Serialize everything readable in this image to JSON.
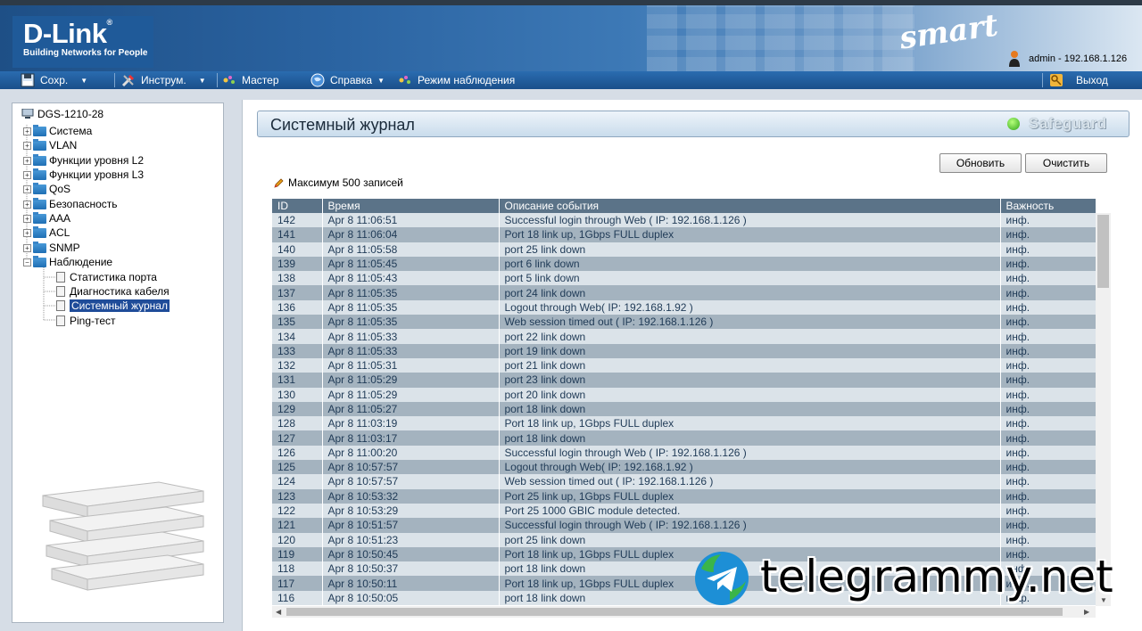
{
  "header": {
    "brand": "D-Link",
    "tagline": "Building Networks for People",
    "product_line": "smart",
    "user_info": "admin - 192.168.1.126"
  },
  "menubar": {
    "save": "Сохр.",
    "tools": "Инструм.",
    "wizard": "Мастер",
    "help": "Справка",
    "surveillance": "Режим наблюдения",
    "logout": "Выход"
  },
  "tree": {
    "root": "DGS-1210-28",
    "items": [
      "Система",
      "VLAN",
      "Функции уровня L2",
      "Функции уровня L3",
      "QoS",
      "Безопасность",
      "AAA",
      "ACL",
      "SNMP",
      "Наблюдение"
    ],
    "children": [
      "Статистика порта",
      "Диагностика кабеля",
      "Системный журнал",
      "Ping-тест"
    ]
  },
  "page": {
    "title": "Системный журнал",
    "badge": "Safeguard",
    "refresh_button": "Обновить",
    "clear_button": "Очистить",
    "note": "Максимум 500 записей"
  },
  "log": {
    "columns": [
      "ID",
      "Время",
      "Описание события",
      "Важность"
    ],
    "rows": [
      [
        "142",
        "Apr 8 11:06:51",
        "Successful login through Web ( IP: 192.168.1.126 )",
        "инф."
      ],
      [
        "141",
        "Apr 8 11:06:04",
        "Port 18 link up, 1Gbps FULL duplex",
        "инф."
      ],
      [
        "140",
        "Apr 8 11:05:58",
        "port 25 link down",
        "инф."
      ],
      [
        "139",
        "Apr 8 11:05:45",
        "port 6 link down",
        "инф."
      ],
      [
        "138",
        "Apr 8 11:05:43",
        "port 5 link down",
        "инф."
      ],
      [
        "137",
        "Apr 8 11:05:35",
        "port 24 link down",
        "инф."
      ],
      [
        "136",
        "Apr 8 11:05:35",
        "Logout through Web( IP: 192.168.1.92 )",
        "инф."
      ],
      [
        "135",
        "Apr 8 11:05:35",
        "Web session timed out ( IP: 192.168.1.126 )",
        "инф."
      ],
      [
        "134",
        "Apr 8 11:05:33",
        "port 22 link down",
        "инф."
      ],
      [
        "133",
        "Apr 8 11:05:33",
        "port 19 link down",
        "инф."
      ],
      [
        "132",
        "Apr 8 11:05:31",
        "port 21 link down",
        "инф."
      ],
      [
        "131",
        "Apr 8 11:05:29",
        "port 23 link down",
        "инф."
      ],
      [
        "130",
        "Apr 8 11:05:29",
        "port 20 link down",
        "инф."
      ],
      [
        "129",
        "Apr 8 11:05:27",
        "port 18 link down",
        "инф."
      ],
      [
        "128",
        "Apr 8 11:03:19",
        "Port 18 link up, 1Gbps FULL duplex",
        "инф."
      ],
      [
        "127",
        "Apr 8 11:03:17",
        "port 18 link down",
        "инф."
      ],
      [
        "126",
        "Apr 8 11:00:20",
        "Successful login through Web ( IP: 192.168.1.126 )",
        "инф."
      ],
      [
        "125",
        "Apr 8 10:57:57",
        "Logout through Web( IP: 192.168.1.92 )",
        "инф."
      ],
      [
        "124",
        "Apr 8 10:57:57",
        "Web session timed out ( IP: 192.168.1.126 )",
        "инф."
      ],
      [
        "123",
        "Apr 8 10:53:32",
        "Port 25 link up, 1Gbps FULL duplex",
        "инф."
      ],
      [
        "122",
        "Apr 8 10:53:29",
        "Port 25 1000 GBIC module detected.",
        "инф."
      ],
      [
        "121",
        "Apr 8 10:51:57",
        "Successful login through Web ( IP: 192.168.1.126 )",
        "инф."
      ],
      [
        "120",
        "Apr 8 10:51:23",
        "port 25 link down",
        "инф."
      ],
      [
        "119",
        "Apr 8 10:50:45",
        "Port 18 link up, 1Gbps FULL duplex",
        "инф."
      ],
      [
        "118",
        "Apr 8 10:50:37",
        "port 18 link down",
        "инф."
      ],
      [
        "117",
        "Apr 8 10:50:11",
        "Port 18 link up, 1Gbps FULL duplex",
        "инф."
      ],
      [
        "116",
        "Apr 8 10:50:05",
        "port 18 link down",
        "инф."
      ]
    ]
  },
  "watermark": "telegrammy.net",
  "colors": {
    "menubar": "#1a4f8a",
    "table_header": "#5b7388",
    "row_light": "#dbe3e9",
    "row_dark": "#a4b3bf",
    "selected": "#1f4c99"
  }
}
